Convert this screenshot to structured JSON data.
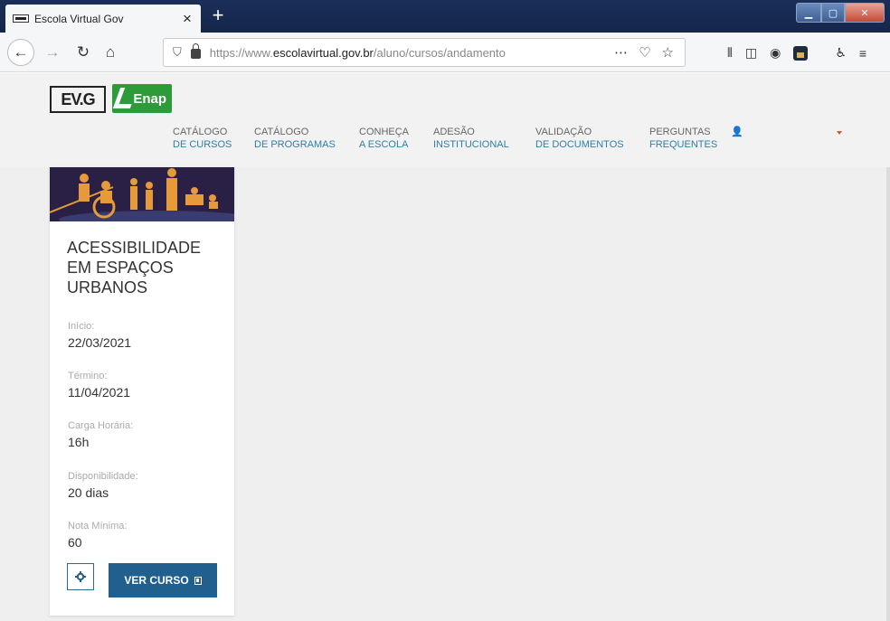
{
  "browser": {
    "tab_title": "Escola Virtual Gov",
    "tab_close": "×",
    "new_tab": "+",
    "url_prefix": "https://www.",
    "url_domain": "escolavirtual.gov.br",
    "url_path": "/aluno/cursos/andamento"
  },
  "site": {
    "logo_evg": "EV.G",
    "logo_enap": "Enap",
    "menu": [
      {
        "line1": "CATÁLOGO",
        "line2": "DE CURSOS"
      },
      {
        "line1": "CATÁLOGO",
        "line2": "DE PROGRAMAS"
      },
      {
        "line1": "CONHEÇA",
        "line2": "A ESCOLA"
      },
      {
        "line1": "ADESÃO",
        "line2": "INSTITUCIONAL"
      },
      {
        "line1": "VALIDAÇÃO",
        "line2": "DE DOCUMENTOS"
      },
      {
        "line1": "PERGUNTAS",
        "line2": "FREQUENTES"
      }
    ]
  },
  "course": {
    "title": "ACESSIBILIDADE EM ESPAÇOS URBANOS",
    "fields": [
      {
        "label": "Início:",
        "value": "22/03/2021"
      },
      {
        "label": "Término:",
        "value": "11/04/2021"
      },
      {
        "label": "Carga Horária:",
        "value": "16h"
      },
      {
        "label": "Disponibilidade:",
        "value": "20 dias"
      },
      {
        "label": "Nota Mínima:",
        "value": "60"
      }
    ],
    "view_button": "VER CURSO"
  }
}
